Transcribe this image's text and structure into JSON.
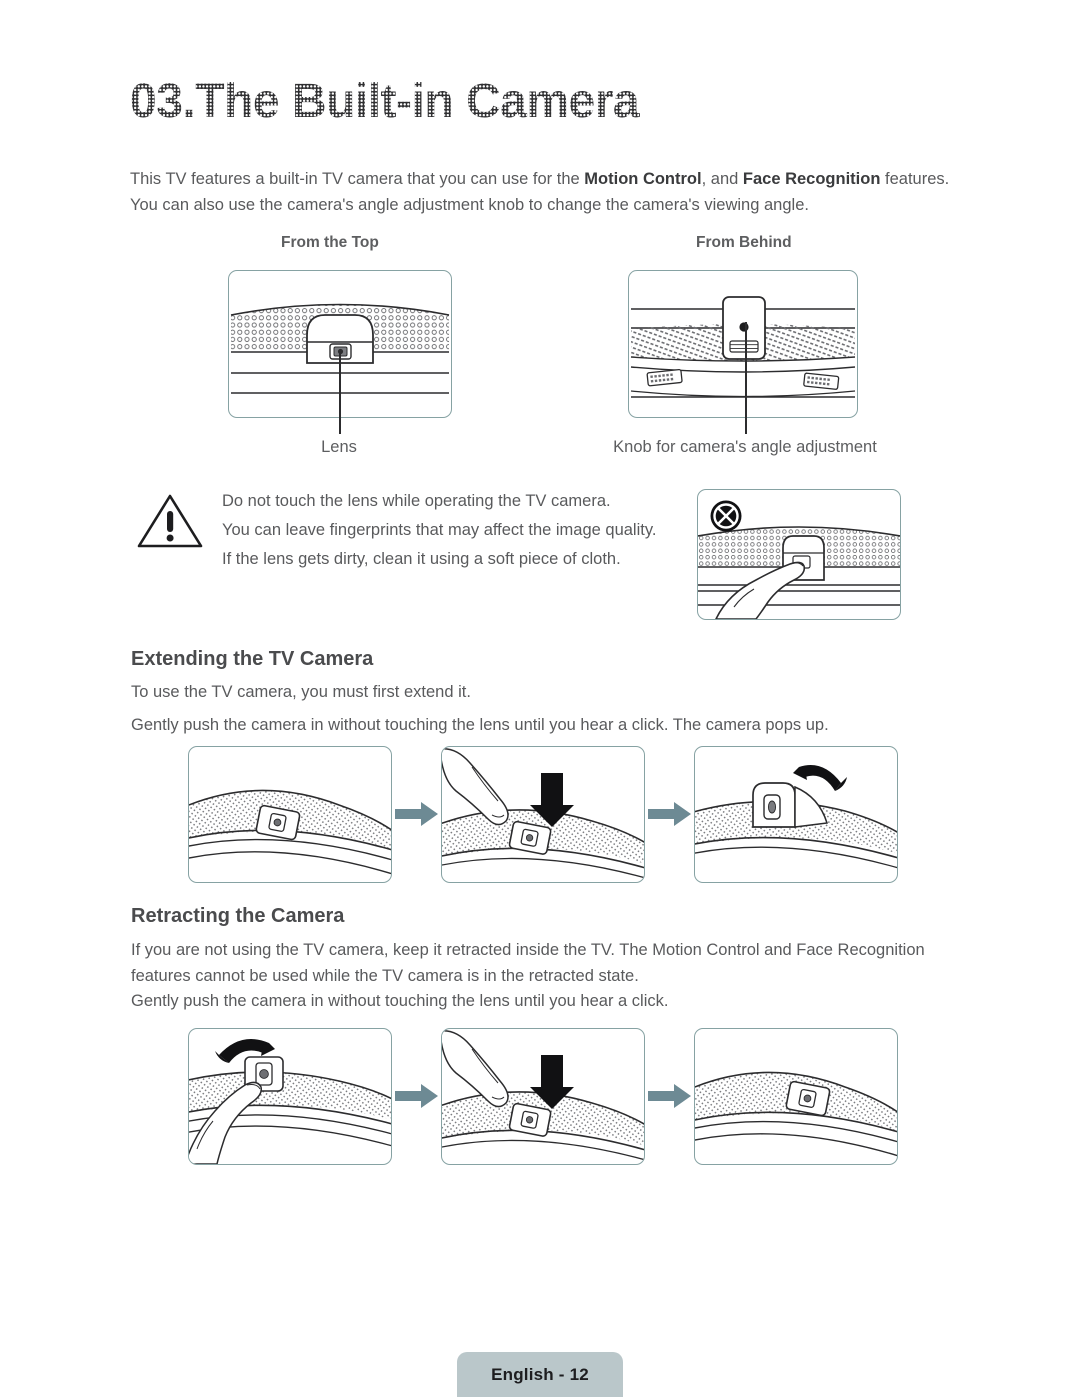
{
  "page": {
    "title": "03.The Built-in Camera",
    "footer_label": "English - 12"
  },
  "intro": {
    "line1_a": "This TV features a built-in TV camera that you can use for the ",
    "bold1": "Motion Control",
    "line1_b": ", and ",
    "bold2": "Face Recognition",
    "line1_c": " features.",
    "line2": "You can also use the camera's angle adjustment knob to change the camera's viewing angle."
  },
  "figures": {
    "top_view_label": "From the Top",
    "behind_view_label": "From Behind",
    "lens_caption": "Lens",
    "knob_caption": "Knob for camera's angle adjustment"
  },
  "warning": {
    "line1": "Do not touch the lens while operating the TV camera.",
    "line2": "You can leave fingerprints that may affect the image quality.",
    "line3": "If the lens gets dirty, clean it using a soft piece of cloth."
  },
  "extending": {
    "heading": "Extending the TV Camera",
    "para1": "To use the TV camera, you must first extend it.",
    "para2": "Gently push the camera in without touching the lens until you hear a click. The camera pops up."
  },
  "retracting": {
    "heading": "Retracting the Camera",
    "para1": "If you are not using the TV camera, keep it retracted inside the TV. The Motion Control and Face Recognition features cannot be used while the TV camera is in the retracted state.",
    "para2": "Gently push the camera in without touching the lens until you hear a click."
  },
  "colors": {
    "panel_border": "#86a2a3",
    "arrow": "#6d8a94",
    "footer_badge": "#bac7ca",
    "body_text": "#595a5c",
    "heading_text": "#4a4b4d"
  },
  "icons": {
    "warning": "warning-triangle-icon",
    "prohibition": "prohibition-x-icon",
    "step_arrow": "right-arrow-icon",
    "press_arrow": "down-arrow-icon",
    "rotate_arrow": "curved-rotate-arrow-icon"
  }
}
